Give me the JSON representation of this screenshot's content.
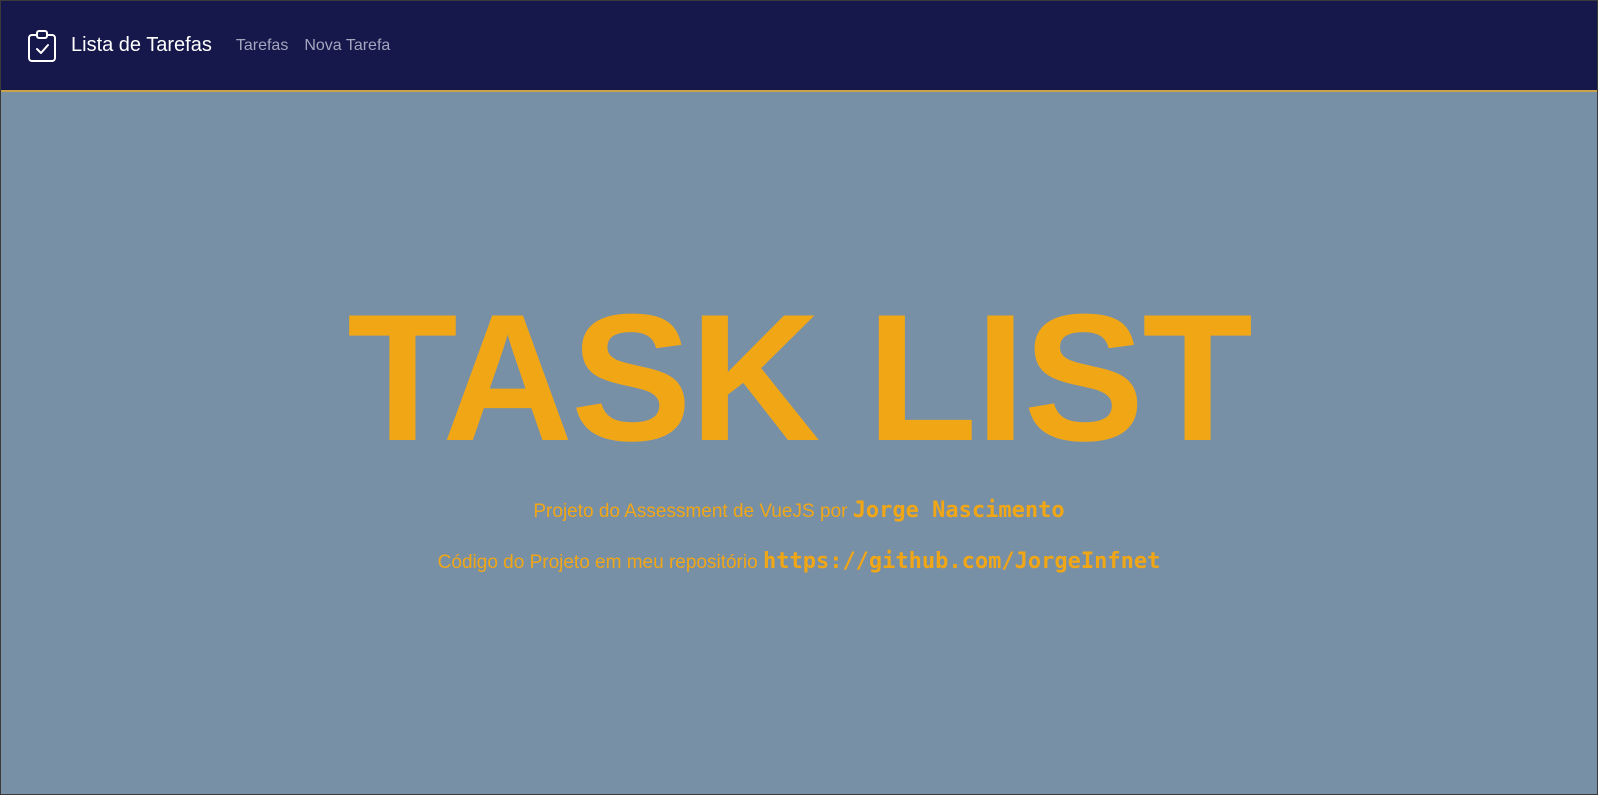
{
  "navbar": {
    "brand_title": "Lista de Tarefas",
    "brand_icon": "clipboard-check-icon",
    "links": [
      {
        "label": "Tarefas"
      },
      {
        "label": "Nova Tarefa"
      }
    ]
  },
  "hero": {
    "title": "TASK LIST",
    "line1_prefix": "Projeto do Assessment de VueJS por",
    "author": "Jorge Nascimento",
    "line2_prefix": "Código do Projeto em meu repositório",
    "repo_url": "https://github.com/JorgeInfnet"
  },
  "colors": {
    "navbar_bg": "#16174a",
    "page_bg": "#7890a6",
    "accent": "#f1a616",
    "nav_link": "#a4a6bf"
  }
}
